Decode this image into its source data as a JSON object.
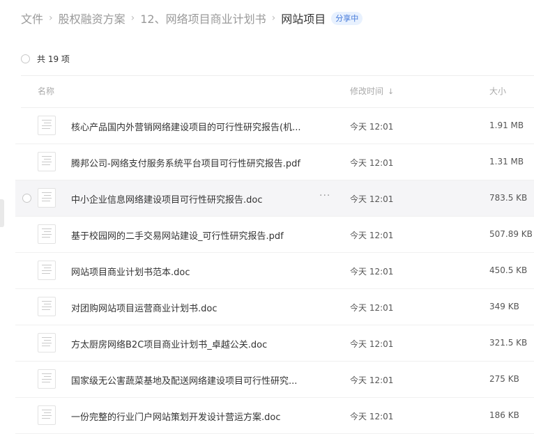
{
  "breadcrumb": {
    "items": [
      "文件",
      "股权融资方案",
      "12、网络项目商业计划书"
    ],
    "separator": "›",
    "current": "网站项目",
    "badge": "分享中"
  },
  "count_label": "共 19 项",
  "columns": {
    "name": "名称",
    "modified": "修改时间",
    "sort_icon": "↓",
    "size": "大小"
  },
  "more_icon": "···",
  "files": [
    {
      "name": "核心产品国内外营销网络建设项目的可行性研究报告(机...",
      "time": "今天 12:01",
      "size": "1.91 MB"
    },
    {
      "name": "腾邦公司-网络支付服务系统平台项目可行性研究报告.pdf",
      "time": "今天 12:01",
      "size": "1.31 MB"
    },
    {
      "name": "中小企业信息网络建设项目可行性研究报告.doc",
      "time": "今天 12:01",
      "size": "783.5 KB"
    },
    {
      "name": "基于校园网的二手交易网站建设_可行性研究报告.pdf",
      "time": "今天 12:01",
      "size": "507.89 KB"
    },
    {
      "name": "网站项目商业计划书范本.doc",
      "time": "今天 12:01",
      "size": "450.5 KB"
    },
    {
      "name": "对团购网站项目运营商业计划书.doc",
      "time": "今天 12:01",
      "size": "349 KB"
    },
    {
      "name": "方太厨房网络B2C项目商业计划书_卓越公关.doc",
      "time": "今天 12:01",
      "size": "321.5 KB"
    },
    {
      "name": "国家级无公害蔬菜基地及配送网络建设项目可行性研究...",
      "time": "今天 12:01",
      "size": "275 KB"
    },
    {
      "name": "一份完整的行业门户网站策划开发设计营运方案.doc",
      "time": "今天 12:01",
      "size": "186 KB"
    }
  ]
}
